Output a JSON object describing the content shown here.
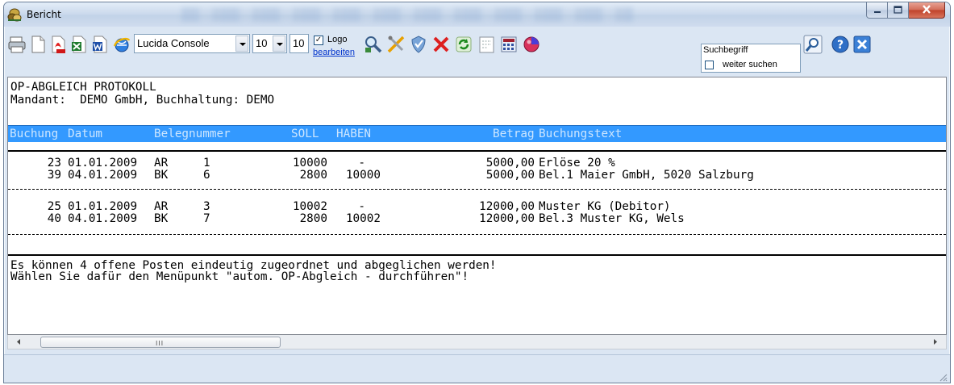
{
  "window": {
    "title": "Bericht",
    "icons": [
      "app-icon",
      "minimize-icon",
      "maximize-icon",
      "close-icon"
    ]
  },
  "toolbar": {
    "font_name": "Lucida Console",
    "font_size": "10",
    "font_size_2": "10",
    "logo_checked": true,
    "logo_label": "Logo",
    "edit_link": "bearbeiten",
    "search_placeholder": "Suchbegriff",
    "continue_search_label": "weiter suchen",
    "icons": [
      "print-icon",
      "new-page-icon",
      "pdf-icon",
      "excel-icon",
      "word-icon",
      "browser-icon",
      "search-icon",
      "tools-icon",
      "shield-icon",
      "delete-icon",
      "refresh-icon",
      "page-setup-icon",
      "calculator-icon",
      "color-icon",
      "find-icon",
      "help-icon",
      "close-report-icon"
    ]
  },
  "report": {
    "title": "OP-ABGLEICH PROTOKOLL",
    "mandant": "Mandant:  DEMO GmbH, Buchhaltung: DEMO",
    "columns": [
      "Buchung",
      "Datum",
      "Belegnummer",
      "SOLL",
      "HABEN",
      "Betrag",
      "Buchungstext"
    ],
    "rows": [
      [
        "23",
        "01.01.2009",
        "AR",
        "1",
        "10000",
        "-",
        "5000,00",
        "Erlöse 20 %"
      ],
      [
        "39",
        "04.01.2009",
        "BK",
        "6",
        "2800",
        "10000",
        "5000,00",
        "Bel.1 Maier GmbH, 5020 Salzburg"
      ],
      [
        "25",
        "01.01.2009",
        "AR",
        "3",
        "10002",
        "-",
        "12000,00",
        "Muster KG (Debitor)"
      ],
      [
        "40",
        "04.01.2009",
        "BK",
        "7",
        "2800",
        "10002",
        "12000,00",
        "Bel.3 Muster KG, Wels"
      ]
    ],
    "footer_1": "Es können 4 offene Posten eindeutig zugeordnet und abgeglichen werden!",
    "footer_2": "Wählen Sie dafür den Menüpunkt \"autom. OP-Abgleich - durchführen\"!"
  },
  "scrollbar": {
    "grip": "III"
  }
}
